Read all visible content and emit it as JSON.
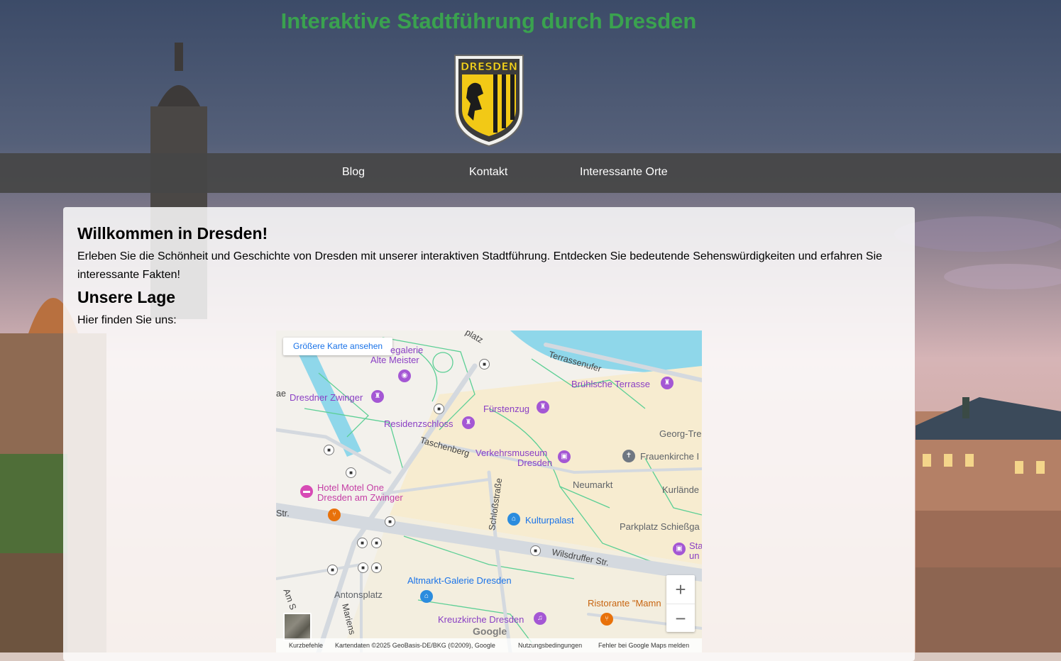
{
  "header": {
    "title": "Interaktive Stadtführung durch Dresden",
    "crest_text": "DRESDEN",
    "title_color": "#3aa24f"
  },
  "nav": {
    "items": [
      {
        "label": "Blog"
      },
      {
        "label": "Kontakt"
      },
      {
        "label": "Interessante Orte"
      }
    ]
  },
  "main": {
    "welcome_heading": "Willkommen in Dresden!",
    "welcome_text": "Erleben Sie die Schönheit und Geschichte von Dresden mit unserer interaktiven Stadtführung. Entdecken Sie bedeutende Sehenswürdigkeiten und erfahren Sie interessante Fakten!",
    "location_heading": "Unsere Lage",
    "location_text": "Hier finden Sie uns:"
  },
  "map": {
    "larger_map_link": "Größere Karte ansehen",
    "places": {
      "gemaeldegalerie_1": "egalerie",
      "gemaeldegalerie_2": "Alte Meister",
      "zwinger": "Dresdner Zwinger",
      "bruehlsche": "Brühlsche Terrasse",
      "fuerstenzug": "Fürstenzug",
      "residenzschloss": "Residenzschloss",
      "verkehrsmuseum_1": "Verkehrsmuseum",
      "verkehrsmuseum_2": "Dresden",
      "frauenkirche": "Frauenkirche I",
      "neumarkt": "Neumarkt",
      "hotel_1": "Hotel Motel One",
      "hotel_2": "Dresden am Zwinger",
      "kulturpalast": "Kulturpalast",
      "parkplatz": "Parkplatz Schießga",
      "altmarkt": "Altmarkt-Galerie Dresden",
      "antonsplatz": "Antonsplatz",
      "kreuzkirche": "Kreuzkirche Dresden",
      "ristorante": "Ristorante \"Mamn",
      "sta_1": "Sta",
      "sta_2": "un"
    },
    "streets": {
      "terrassenufer": "Terrassenufer",
      "taschenberg": "Taschenberg",
      "schlossstrasse": "Schloßstraße",
      "wilsdruffer": "Wilsdruffer Str.",
      "georg": "Georg-Tre",
      "kurlaende": "Kurlände",
      "platz": "platz",
      "str_left": "Str.",
      "ae": "ae",
      "am_s": "Am S",
      "marien": "Mariens"
    },
    "zoom_in": "+",
    "zoom_out": "−",
    "google_logo": "Google",
    "footer": {
      "shortcuts": "Kurzbefehle",
      "map_data": "Kartendaten ©2025 GeoBasis-DE/BKG (©2009), Google",
      "terms": "Nutzungsbedingungen",
      "report": "Fehler bei Google Maps melden"
    },
    "colors": {
      "water": "#8fd7ea",
      "land": "#f3f1ec",
      "building": "#f7ecd0",
      "road": "#d4d9df",
      "park_path": "#5ccf95"
    }
  }
}
